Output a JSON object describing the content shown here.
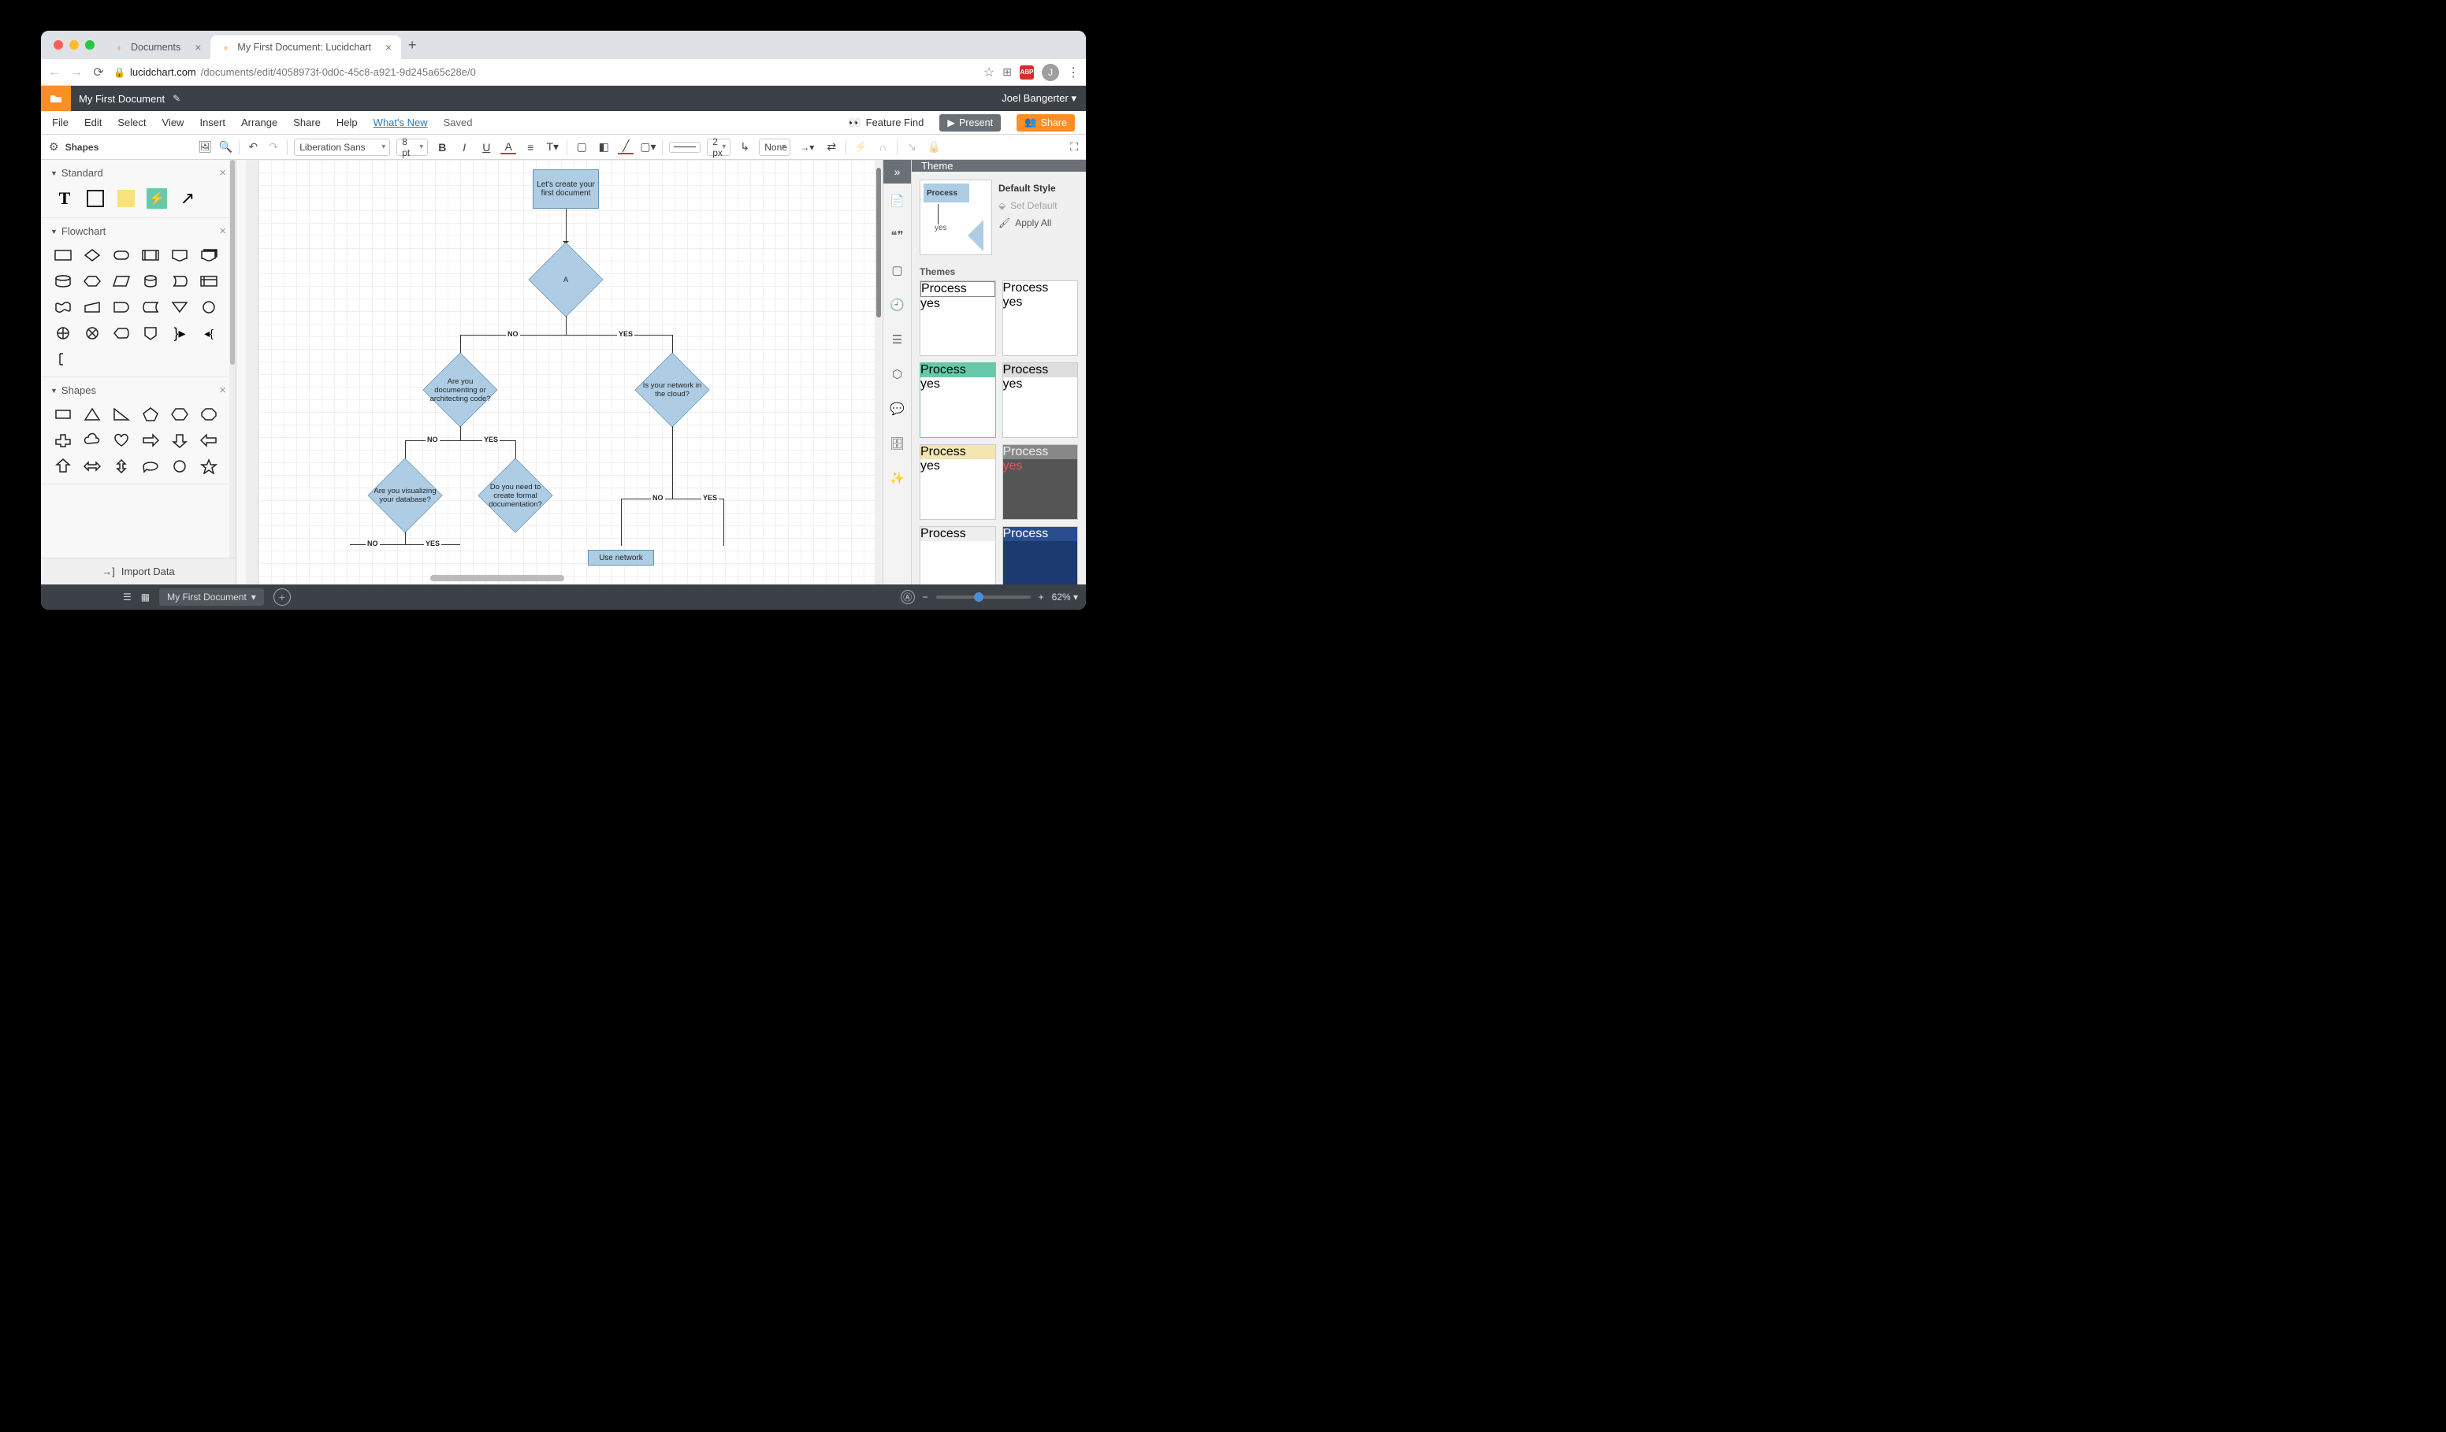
{
  "browser": {
    "tabs": [
      {
        "title": "Documents"
      },
      {
        "title": "My First Document: Lucidchart"
      }
    ],
    "url_domain": "lucidchart.com",
    "url_path": "/documents/edit/4058973f-0d0c-45c8-a921-9d245a65c28e/0",
    "avatar": "J",
    "adblock": "ABP"
  },
  "app": {
    "doc_name": "My First Document",
    "user": "Joel Bangerter",
    "menus": [
      "File",
      "Edit",
      "Select",
      "View",
      "Insert",
      "Arrange",
      "Share",
      "Help"
    ],
    "whats_new": "What's New",
    "saved": "Saved",
    "feature_find": "Feature Find",
    "present": "Present",
    "share": "Share"
  },
  "toolbar": {
    "shapes": "Shapes",
    "font": "Liberation Sans",
    "size": "8 pt",
    "line_w": "2 px",
    "line_style": "None"
  },
  "left": {
    "cat1": "Standard",
    "cat2": "Flowchart",
    "cat3": "Shapes",
    "import": "Import Data"
  },
  "right": {
    "title": "Theme",
    "default": "Default Style",
    "set_default": "Set Default",
    "apply_all": "Apply All",
    "themes": "Themes",
    "process": "Process",
    "yes": "yes"
  },
  "canvas": {
    "n1": "Let's create your first document",
    "a": "A",
    "q1": "Are you documenting or architecting code?",
    "q2": "Is your network in the cloud?",
    "q3": "Are you visualizing your database?",
    "q4": "Do you need to create formal documentation?",
    "n2": "Use network",
    "no": "NO",
    "yes": "YES"
  },
  "footer": {
    "page": "My First Document",
    "zoom": "62%"
  }
}
